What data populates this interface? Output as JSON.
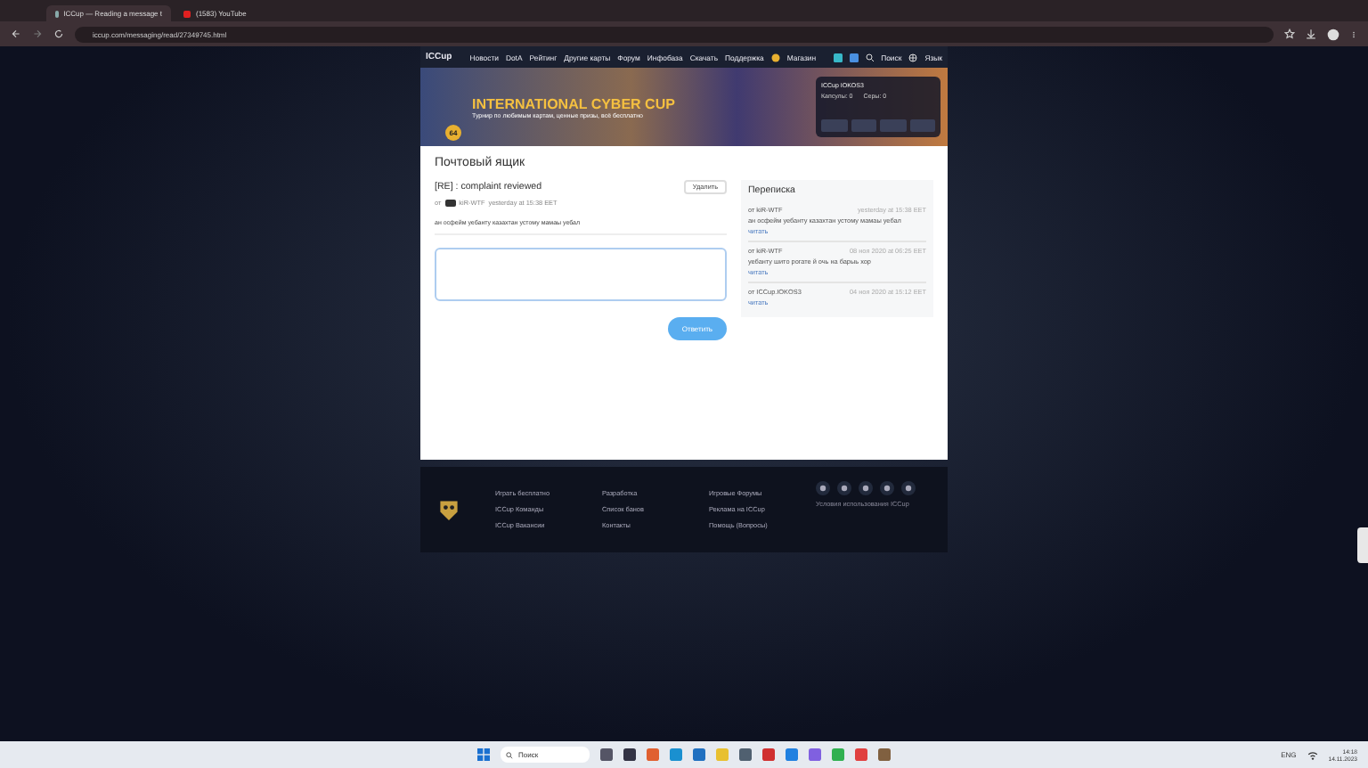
{
  "browser": {
    "tabs": [
      {
        "title": "ICCup — Reading a message t",
        "selected": true
      },
      {
        "title": "(1583) YouTube",
        "selected": false
      }
    ],
    "url": "iccup.com/messaging/read/27349745.html"
  },
  "nav": {
    "logo": "ICCup",
    "items": [
      "Новости",
      "DotA",
      "Рейтинг",
      "Другие карты",
      "Форум",
      "Инфобаза",
      "Скачать",
      "Поддержка"
    ],
    "shop": "Магазин",
    "search": "Поиск",
    "language": "Язык"
  },
  "banner": {
    "title": "INTERNATIONAL CYBER CUP",
    "subtitle": "Турнир по любимым картам, ценные призы, всё бесплатно",
    "badge": "64"
  },
  "profile": {
    "name": "ICCup IOKOS3",
    "stats": [
      "Капсулы: 0",
      "Серы: 0"
    ]
  },
  "mailbox": {
    "heading": "Почтовый ящик",
    "subject": "[RE] : complaint reviewed",
    "delete": "Удалить",
    "from_label": "от",
    "sender": "kiR-WTF",
    "date": "yesterday at 15:38 EET",
    "body": "ан осфейм уебанту казахтан устому мамаы уебал",
    "reply": "Ответить"
  },
  "thread": {
    "heading": "Переписка",
    "items": [
      {
        "from": "от kiR-WTF",
        "date": "yesterday at 15:38 EET",
        "text": "ан осфейм уебанту казахтан устому мамаы уебал",
        "link": "читать"
      },
      {
        "from": "от kiR-WTF",
        "date": "08 ноя 2020 at 06:25 EET",
        "text": "уебанту шито рогате й очь на барыь хор",
        "link": "читать"
      },
      {
        "from": "от ICCup.IOKOS3",
        "date": "04 ноя 2020 at 15:12 EET",
        "link": "читать"
      }
    ]
  },
  "footer": {
    "columns": [
      [
        "Играть бесплатно",
        "ICCup Команды",
        "ICCup Вакансии"
      ],
      [
        "Разработка",
        "Список банов",
        "Контакты"
      ],
      [
        "Игровые Форумы",
        "Реклама на ICCup",
        "Помощь (Вопросы)"
      ]
    ],
    "note": "Условия использования ICCup"
  },
  "taskbar": {
    "search": "Поиск",
    "language": "ENG",
    "time": "14:18",
    "date": "14.11.2023"
  }
}
